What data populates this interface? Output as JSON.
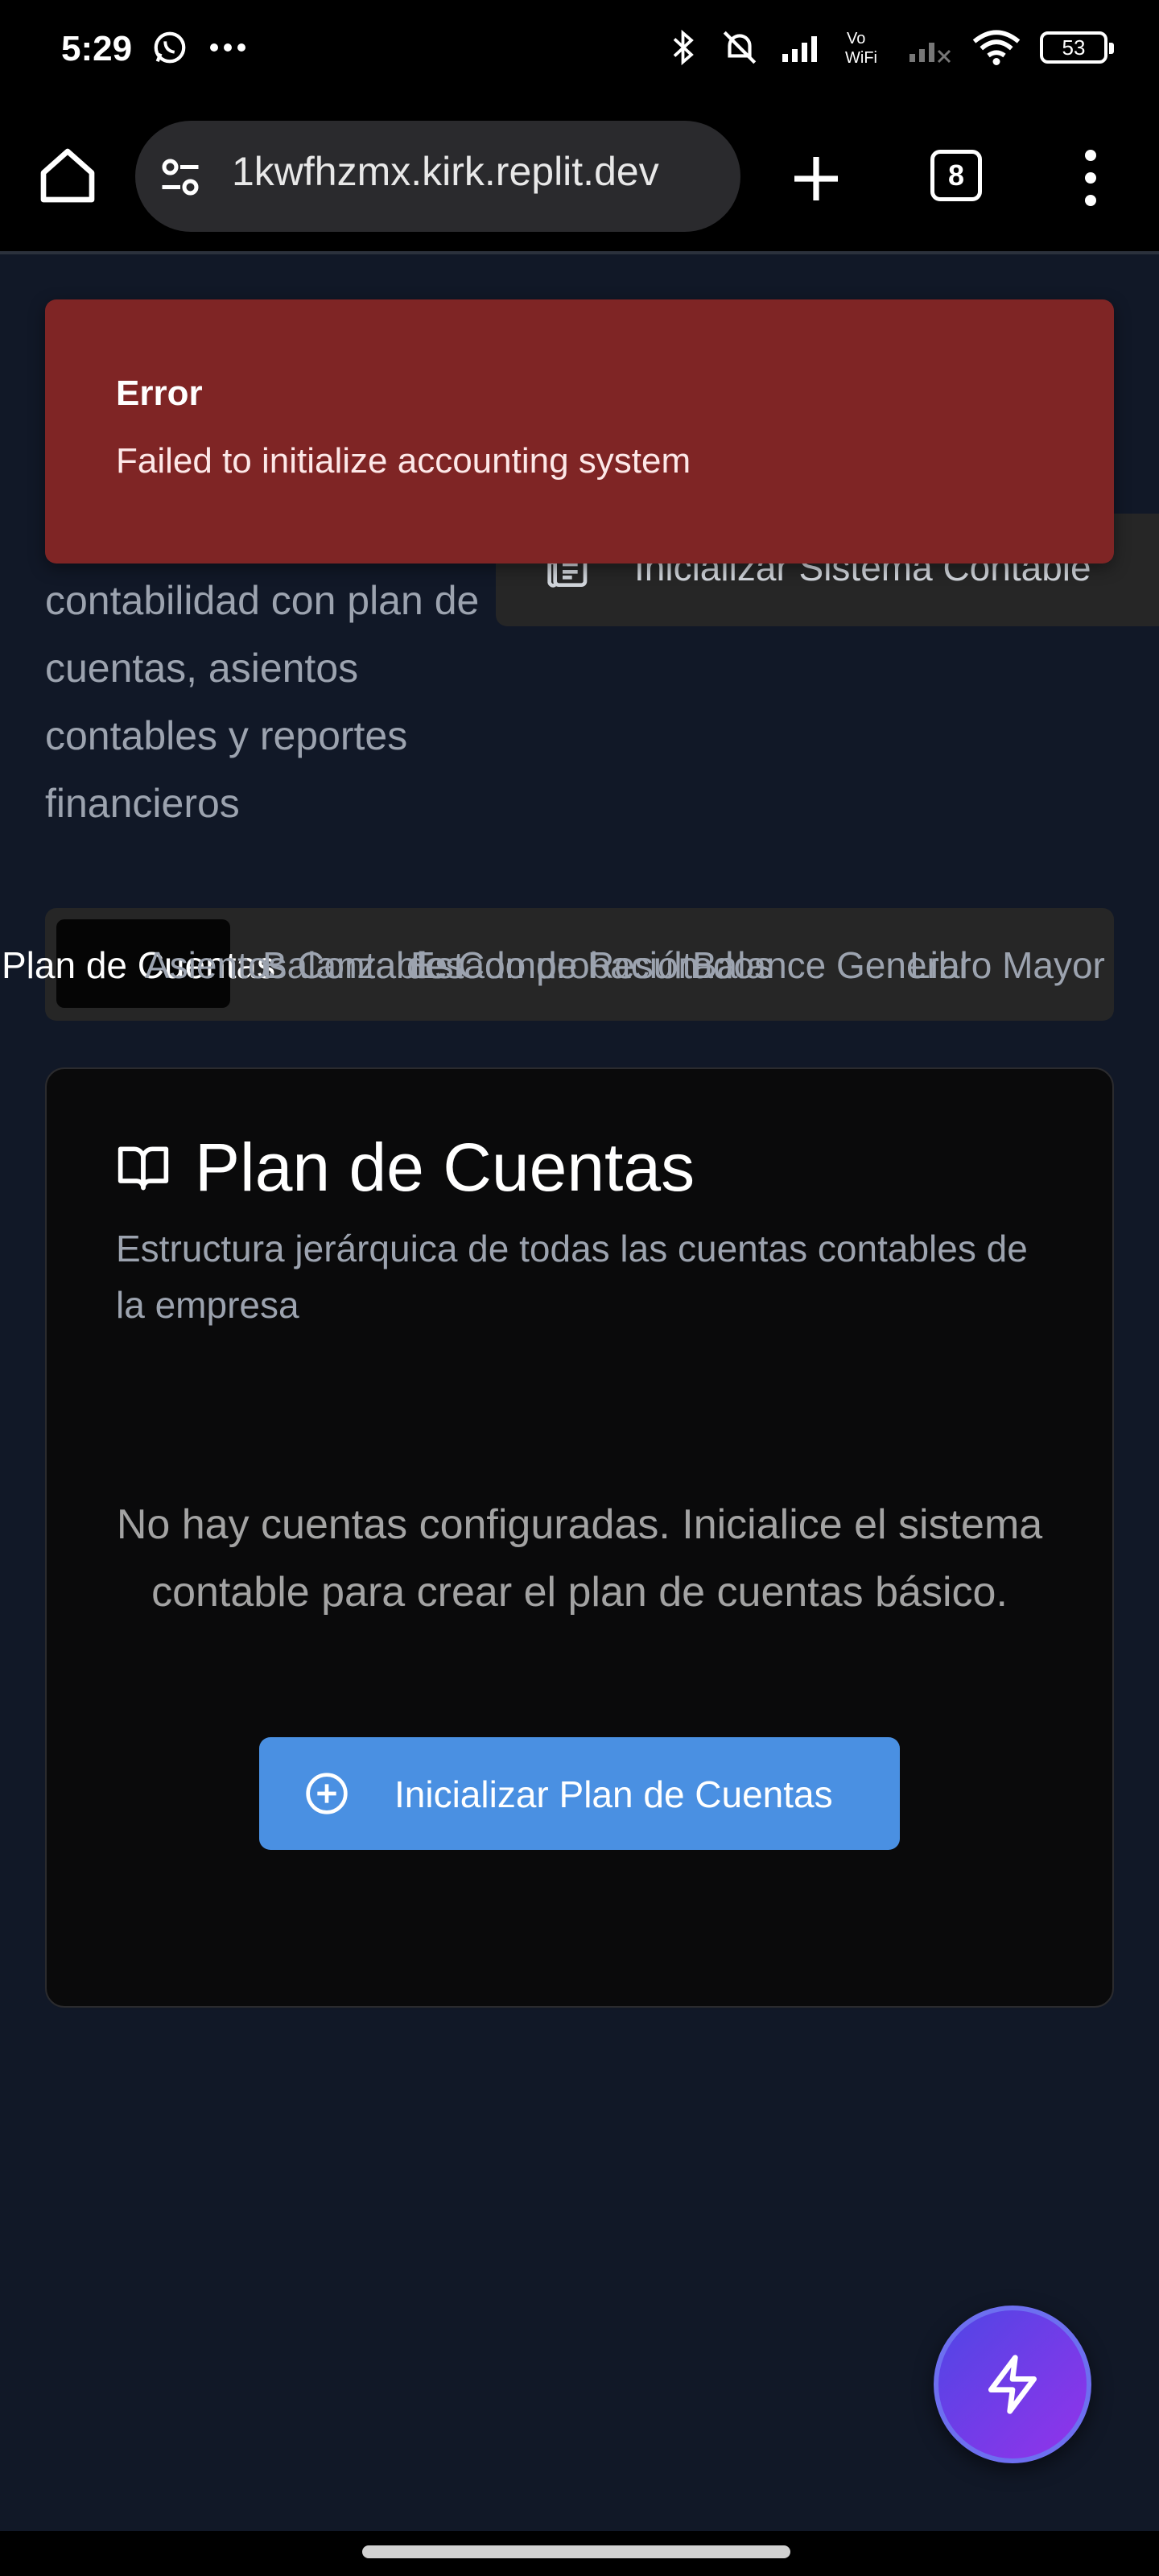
{
  "status_bar": {
    "time": "5:29",
    "battery": "53",
    "icons": [
      "whatsapp-icon",
      "more-dots-icon",
      "bluetooth-icon",
      "mute-icon",
      "signal-icon",
      "vowifi-icon",
      "wifi-icon",
      "battery-icon"
    ]
  },
  "browser": {
    "url": "1kwfhzmx.kirk.replit.dev",
    "tab_count": "8"
  },
  "page": {
    "description": "contabilidad con plan de cuentas, asientos contables y reportes financieros",
    "init_system_button": "Inicializar Sistema Contable",
    "tabs": [
      {
        "label": "Plan de Cuentas"
      },
      {
        "label": "Asientos Contables"
      },
      {
        "label": "Balanza de Comprobación"
      },
      {
        "label": "Estado de Resultados"
      },
      {
        "label": "Balance General"
      },
      {
        "label": "Libro Mayor"
      }
    ]
  },
  "toast": {
    "title": "Error",
    "message": "Failed to initialize accounting system"
  },
  "card": {
    "title": "Plan de Cuentas",
    "subtitle": "Estructura jerárquica de todas las cuentas contables de la empresa",
    "empty_message": "No hay cuentas configuradas. Inicialice el sistema contable para crear el plan de cuentas básico.",
    "button": "Inicializar Plan de Cuentas"
  },
  "colors": {
    "background": "#111827",
    "error": "#7f2525",
    "primary": "#4a90e2",
    "fab_start": "#4f46e5",
    "fab_end": "#9333ea"
  }
}
